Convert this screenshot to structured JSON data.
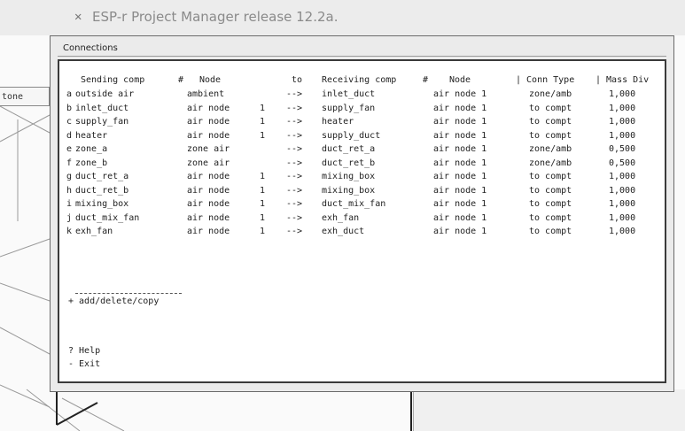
{
  "window": {
    "title": "ESP-r Project Manager release 12.2a."
  },
  "background": {
    "label": "tone"
  },
  "dialog": {
    "title": "Connections",
    "headers": {
      "sending": "Sending comp",
      "s_num": "#",
      "s_node": "Node",
      "to": "to",
      "receiving": "Receiving comp",
      "r_num": "#",
      "r_node": "Node",
      "conn_type": "| Conn Type",
      "mass": "| Mass Div"
    },
    "rows": [
      {
        "key": "a",
        "send": "outside air",
        "snode": "ambient",
        "snum": "",
        "arrow": "-->",
        "recv": "inlet_duct",
        "rnode": "air node 1",
        "type": "zone/amb",
        "mass": "1,000"
      },
      {
        "key": "b",
        "send": "inlet_duct",
        "snode": "air node",
        "snum": "1",
        "arrow": "-->",
        "recv": "supply_fan",
        "rnode": "air node 1",
        "type": "to compt",
        "mass": "1,000"
      },
      {
        "key": "c",
        "send": "supply_fan",
        "snode": "air node",
        "snum": "1",
        "arrow": "-->",
        "recv": "heater",
        "rnode": "air node 1",
        "type": "to compt",
        "mass": "1,000"
      },
      {
        "key": "d",
        "send": "heater",
        "snode": "air node",
        "snum": "1",
        "arrow": "-->",
        "recv": "supply_duct",
        "rnode": "air node 1",
        "type": "to compt",
        "mass": "1,000"
      },
      {
        "key": "e",
        "send": "zone_a",
        "snode": "zone air",
        "snum": "",
        "arrow": "-->",
        "recv": "duct_ret_a",
        "rnode": "air node 1",
        "type": "zone/amb",
        "mass": "0,500"
      },
      {
        "key": "f",
        "send": "zone_b",
        "snode": "zone air",
        "snum": "",
        "arrow": "-->",
        "recv": "duct_ret_b",
        "rnode": "air node 1",
        "type": "zone/amb",
        "mass": "0,500"
      },
      {
        "key": "g",
        "send": "duct_ret_a",
        "snode": "air node",
        "snum": "1",
        "arrow": "-->",
        "recv": "mixing_box",
        "rnode": "air node 1",
        "type": "to compt",
        "mass": "1,000"
      },
      {
        "key": "h",
        "send": "duct_ret_b",
        "snode": "air node",
        "snum": "1",
        "arrow": "-->",
        "recv": "mixing_box",
        "rnode": "air node 1",
        "type": "to compt",
        "mass": "1,000"
      },
      {
        "key": "i",
        "send": "mixing_box",
        "snode": "air node",
        "snum": "1",
        "arrow": "-->",
        "recv": "duct_mix_fan",
        "rnode": "air node 1",
        "type": "to compt",
        "mass": "1,000"
      },
      {
        "key": "j",
        "send": "duct_mix_fan",
        "snode": "air node",
        "snum": "1",
        "arrow": "-->",
        "recv": "exh_fan",
        "rnode": "air node 1",
        "type": "to compt",
        "mass": "1,000"
      },
      {
        "key": "k",
        "send": "exh_fan",
        "snode": "air node",
        "snum": "1",
        "arrow": "-->",
        "recv": "exh_duct",
        "rnode": "air node 1",
        "type": "to compt",
        "mass": "1,000"
      }
    ],
    "separator": "-------------------",
    "add_label": "+ add/delete/copy",
    "help_label": "? Help",
    "exit_label": "- Exit"
  }
}
